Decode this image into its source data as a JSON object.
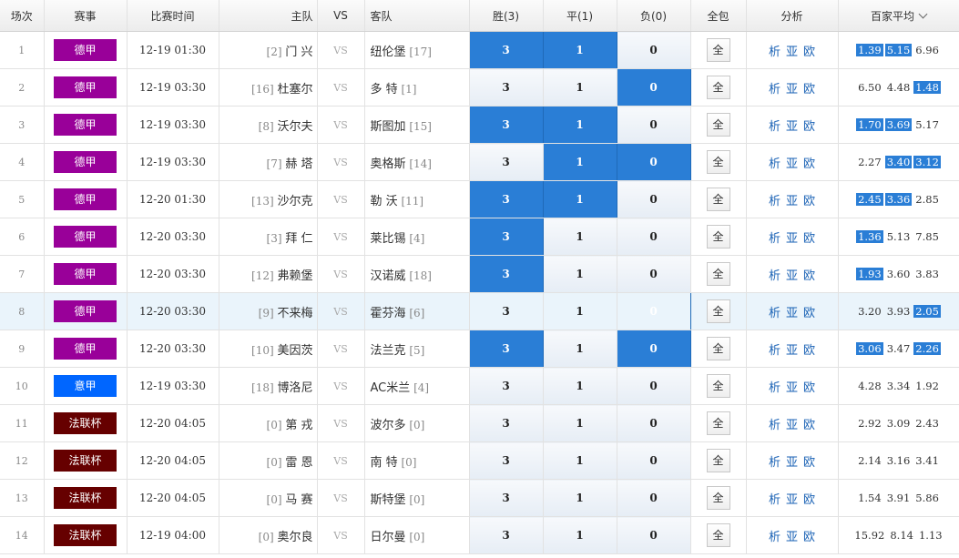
{
  "header": {
    "no": "场次",
    "league": "赛事",
    "time": "比赛时间",
    "home": "主队",
    "vs": "VS",
    "away": "客队",
    "win": "胜(3)",
    "draw": "平(1)",
    "lose": "负(0)",
    "all": "全包",
    "analysis": "分析",
    "avg": "百家平均"
  },
  "colors": {
    "bundesliga": "#990099",
    "seriea": "#0066ff",
    "coupe": "#660000",
    "selected": "#2a7ed6"
  },
  "labels": {
    "vs": "VS",
    "all": "全",
    "xi": "析",
    "ya": "亚",
    "ou": "欧"
  },
  "rows": [
    {
      "no": "1",
      "league": "德甲",
      "league_color": "#990099",
      "time": "12-19 01:30",
      "home_rank": "[2]",
      "home": "门 兴",
      "away": "纽伦堡",
      "away_rank": "[17]",
      "win": "3",
      "draw": "1",
      "lose": "0",
      "sel": [
        true,
        true,
        false
      ],
      "odds": [
        "1.39",
        "5.15",
        "6.96"
      ],
      "odds_hl": [
        true,
        true,
        false
      ],
      "highlight": false
    },
    {
      "no": "2",
      "league": "德甲",
      "league_color": "#990099",
      "time": "12-19 03:30",
      "home_rank": "[16]",
      "home": "杜塞尔",
      "away": "多 特",
      "away_rank": "[1]",
      "win": "3",
      "draw": "1",
      "lose": "0",
      "sel": [
        false,
        false,
        true
      ],
      "odds": [
        "6.50",
        "4.48",
        "1.48"
      ],
      "odds_hl": [
        false,
        false,
        true
      ],
      "highlight": false
    },
    {
      "no": "3",
      "league": "德甲",
      "league_color": "#990099",
      "time": "12-19 03:30",
      "home_rank": "[8]",
      "home": "沃尔夫",
      "away": "斯图加",
      "away_rank": "[15]",
      "win": "3",
      "draw": "1",
      "lose": "0",
      "sel": [
        true,
        true,
        false
      ],
      "odds": [
        "1.70",
        "3.69",
        "5.17"
      ],
      "odds_hl": [
        true,
        true,
        false
      ],
      "highlight": false
    },
    {
      "no": "4",
      "league": "德甲",
      "league_color": "#990099",
      "time": "12-19 03:30",
      "home_rank": "[7]",
      "home": "赫 塔",
      "away": "奥格斯",
      "away_rank": "[14]",
      "win": "3",
      "draw": "1",
      "lose": "0",
      "sel": [
        false,
        true,
        true
      ],
      "odds": [
        "2.27",
        "3.40",
        "3.12"
      ],
      "odds_hl": [
        false,
        true,
        true
      ],
      "highlight": false
    },
    {
      "no": "5",
      "league": "德甲",
      "league_color": "#990099",
      "time": "12-20 01:30",
      "home_rank": "[13]",
      "home": "沙尔克",
      "away": "勒 沃",
      "away_rank": "[11]",
      "win": "3",
      "draw": "1",
      "lose": "0",
      "sel": [
        true,
        true,
        false
      ],
      "odds": [
        "2.45",
        "3.36",
        "2.85"
      ],
      "odds_hl": [
        true,
        true,
        false
      ],
      "highlight": false
    },
    {
      "no": "6",
      "league": "德甲",
      "league_color": "#990099",
      "time": "12-20 03:30",
      "home_rank": "[3]",
      "home": "拜 仁",
      "away": "莱比锡",
      "away_rank": "[4]",
      "win": "3",
      "draw": "1",
      "lose": "0",
      "sel": [
        true,
        false,
        false
      ],
      "odds": [
        "1.36",
        "5.13",
        "7.85"
      ],
      "odds_hl": [
        true,
        false,
        false
      ],
      "highlight": false
    },
    {
      "no": "7",
      "league": "德甲",
      "league_color": "#990099",
      "time": "12-20 03:30",
      "home_rank": "[12]",
      "home": "弗赖堡",
      "away": "汉诺威",
      "away_rank": "[18]",
      "win": "3",
      "draw": "1",
      "lose": "0",
      "sel": [
        true,
        false,
        false
      ],
      "odds": [
        "1.93",
        "3.60",
        "3.83"
      ],
      "odds_hl": [
        true,
        false,
        false
      ],
      "highlight": false
    },
    {
      "no": "8",
      "league": "德甲",
      "league_color": "#990099",
      "time": "12-20 03:30",
      "home_rank": "[9]",
      "home": "不来梅",
      "away": "霍芬海",
      "away_rank": "[6]",
      "win": "3",
      "draw": "1",
      "lose": "0",
      "sel": [
        false,
        false,
        true
      ],
      "odds": [
        "3.20",
        "3.93",
        "2.05"
      ],
      "odds_hl": [
        false,
        false,
        true
      ],
      "highlight": true
    },
    {
      "no": "9",
      "league": "德甲",
      "league_color": "#990099",
      "time": "12-20 03:30",
      "home_rank": "[10]",
      "home": "美因茨",
      "away": "法兰克",
      "away_rank": "[5]",
      "win": "3",
      "draw": "1",
      "lose": "0",
      "sel": [
        true,
        false,
        true
      ],
      "odds": [
        "3.06",
        "3.47",
        "2.26"
      ],
      "odds_hl": [
        true,
        false,
        true
      ],
      "highlight": false
    },
    {
      "no": "10",
      "league": "意甲",
      "league_color": "#0066ff",
      "time": "12-19 03:30",
      "home_rank": "[18]",
      "home": "博洛尼",
      "away": "AC米兰",
      "away_rank": "[4]",
      "win": "3",
      "draw": "1",
      "lose": "0",
      "sel": [
        false,
        false,
        false
      ],
      "odds": [
        "4.28",
        "3.34",
        "1.92"
      ],
      "odds_hl": [
        false,
        false,
        false
      ],
      "highlight": false
    },
    {
      "no": "11",
      "league": "法联杯",
      "league_color": "#660000",
      "time": "12-20 04:05",
      "home_rank": "[0]",
      "home": "第 戎",
      "away": "波尔多",
      "away_rank": "[0]",
      "win": "3",
      "draw": "1",
      "lose": "0",
      "sel": [
        false,
        false,
        false
      ],
      "odds": [
        "2.92",
        "3.09",
        "2.43"
      ],
      "odds_hl": [
        false,
        false,
        false
      ],
      "highlight": false
    },
    {
      "no": "12",
      "league": "法联杯",
      "league_color": "#660000",
      "time": "12-20 04:05",
      "home_rank": "[0]",
      "home": "雷 恩",
      "away": "南 特",
      "away_rank": "[0]",
      "win": "3",
      "draw": "1",
      "lose": "0",
      "sel": [
        false,
        false,
        false
      ],
      "odds": [
        "2.14",
        "3.16",
        "3.41"
      ],
      "odds_hl": [
        false,
        false,
        false
      ],
      "highlight": false
    },
    {
      "no": "13",
      "league": "法联杯",
      "league_color": "#660000",
      "time": "12-20 04:05",
      "home_rank": "[0]",
      "home": "马 赛",
      "away": "斯特堡",
      "away_rank": "[0]",
      "win": "3",
      "draw": "1",
      "lose": "0",
      "sel": [
        false,
        false,
        false
      ],
      "odds": [
        "1.54",
        "3.91",
        "5.86"
      ],
      "odds_hl": [
        false,
        false,
        false
      ],
      "highlight": false
    },
    {
      "no": "14",
      "league": "法联杯",
      "league_color": "#660000",
      "time": "12-19 04:00",
      "home_rank": "[0]",
      "home": "奥尔良",
      "away": "日尔曼",
      "away_rank": "[0]",
      "win": "3",
      "draw": "1",
      "lose": "0",
      "sel": [
        false,
        false,
        false
      ],
      "odds": [
        "15.92",
        "8.14",
        "1.13"
      ],
      "odds_hl": [
        false,
        false,
        false
      ],
      "highlight": false
    }
  ]
}
